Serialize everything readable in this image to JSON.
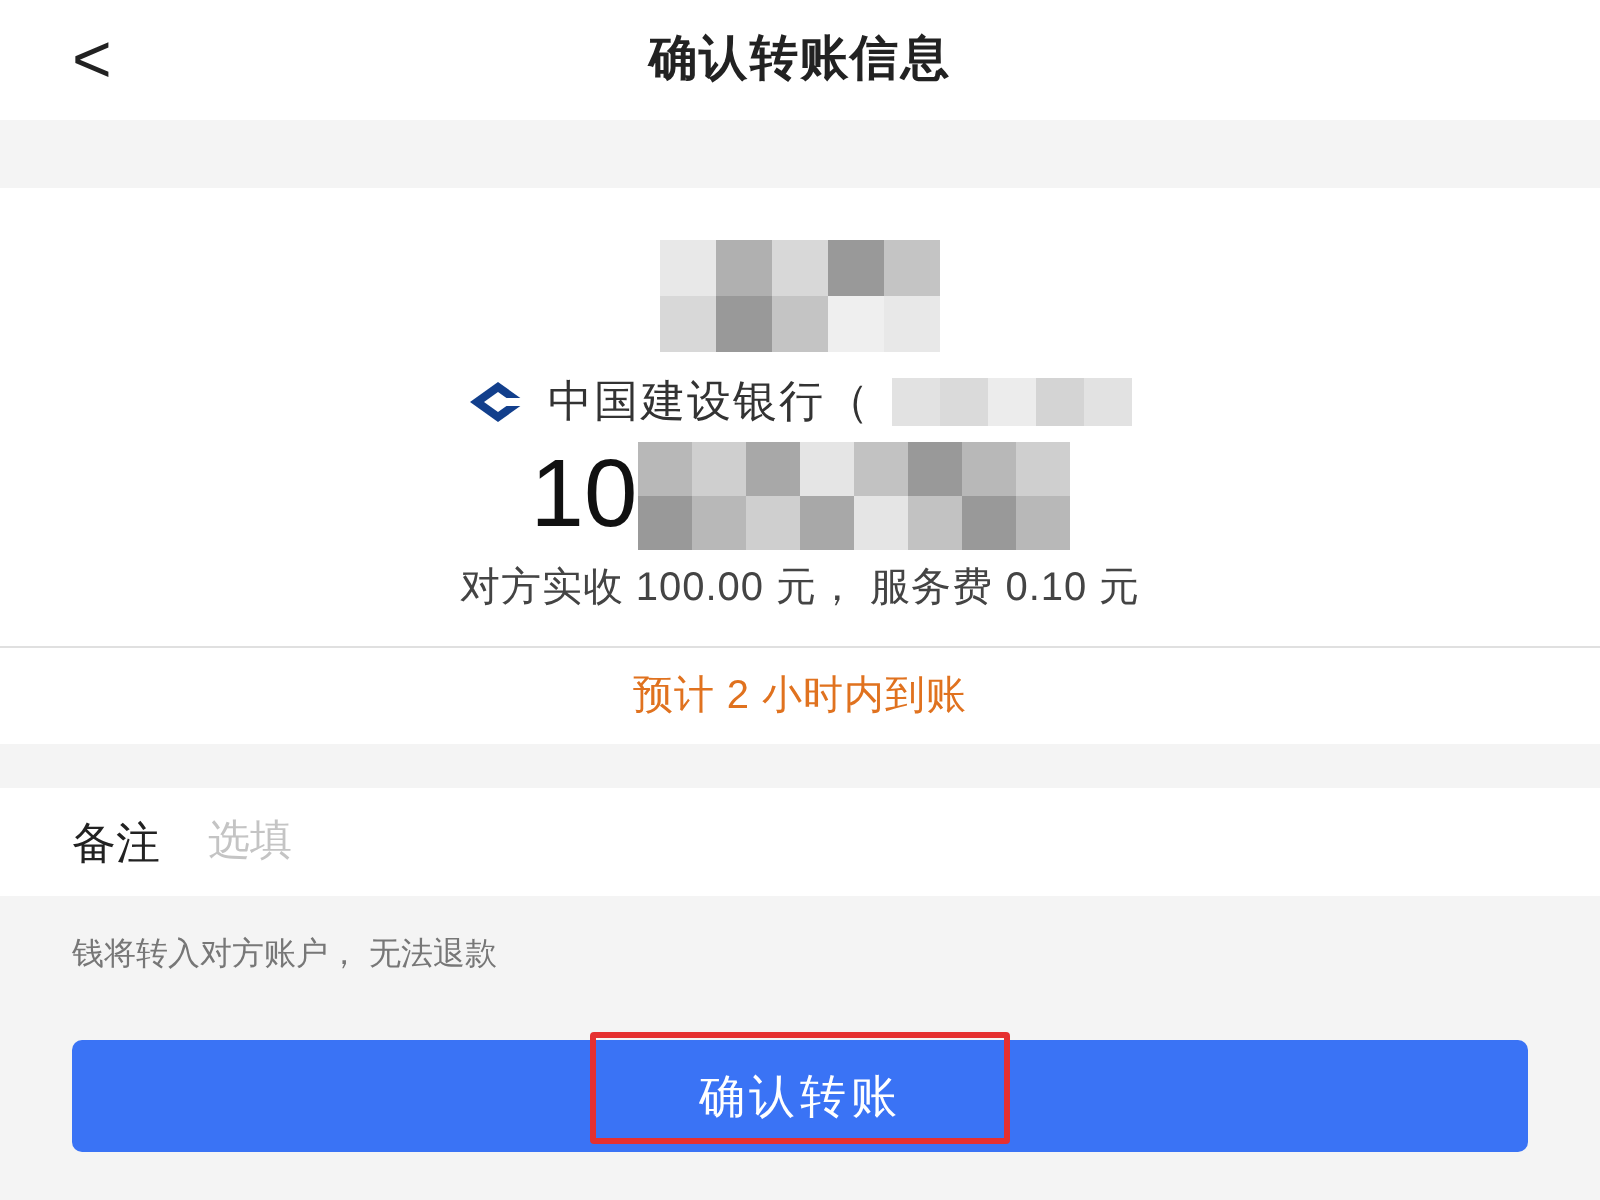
{
  "header": {
    "back": "<",
    "title": "确认转账信息"
  },
  "payee": {
    "bank": "中国建设银行（",
    "amount": "10",
    "detail": "对方实收 100.00 元， 服务费 0.10 元"
  },
  "arrival": "预计 2 小时内到账",
  "remark": {
    "label": "备注",
    "placeholder": "选填"
  },
  "notice": "钱将转入对方账户， 无法退款",
  "confirm": {
    "label": "确认转账",
    "highlighted": true
  }
}
